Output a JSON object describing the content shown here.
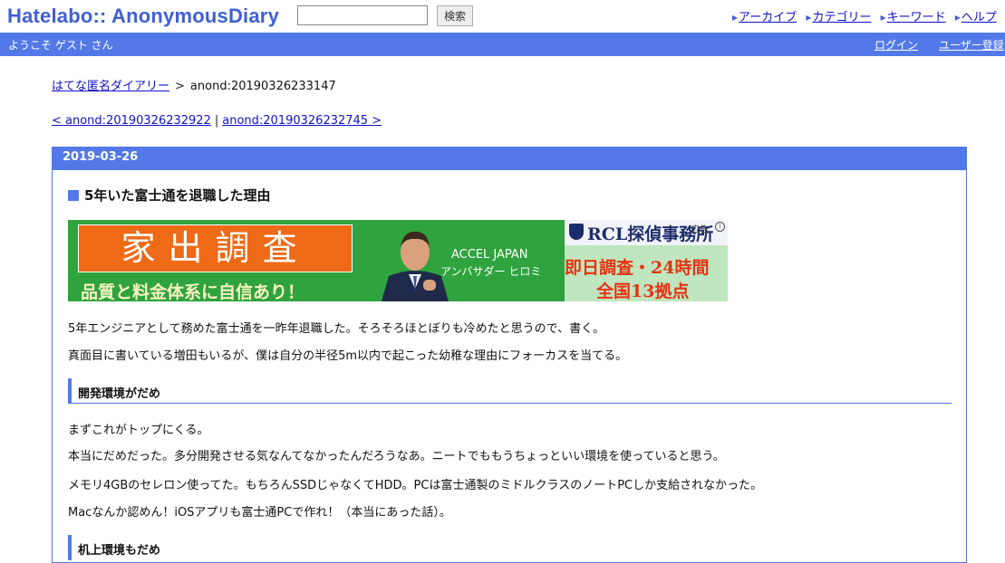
{
  "header": {
    "logo": "Hatelabo:: AnonymousDiary",
    "search_placeholder": "",
    "search_button": "検索",
    "nav": [
      {
        "label": "アーカイブ"
      },
      {
        "label": "カテゴリー"
      },
      {
        "label": "キーワード"
      },
      {
        "label": "ヘルプ"
      }
    ]
  },
  "userbar": {
    "welcome": "ようこそ ゲスト さん",
    "login": "ログイン",
    "register": "ユーザー登録"
  },
  "breadcrumb": {
    "home": "はてな匿名ダイアリー",
    "separator": ">",
    "current": "anond:20190326233147"
  },
  "prevnext": {
    "prev": "< anond:20190326232922",
    "separator": "|",
    "next": "anond:20190326232745 >"
  },
  "section": {
    "date": "2019-03-26",
    "title": "5年いた富士通を退職した理由"
  },
  "ad": {
    "headline": "家出調査",
    "subline": "品質と料金体系に自信あり！",
    "caption1": "ACCEL JAPAN",
    "caption2": "アンバサダー ヒロミ",
    "brand": "RCL探偵事務所",
    "badge": "広告",
    "red1": "即日調査・24時間",
    "red2": "全国13拠点"
  },
  "body": {
    "intro": [
      "5年エンジニアとして務めた富士通を一昨年退職した。そろそろほとぼりも冷めたと思うので、書く。",
      "真面目に書いている増田もいるが、僕は自分の半径5m以内で起こった幼稚な理由にフォーカスを当てる。"
    ],
    "section1_heading": "開発環境がだめ",
    "section1": [
      "まずこれがトップにくる。",
      "本当にだめだった。多分開発させる気なんてなかったんだろうなあ。ニートでももうちょっといい環境を使っていると思う。",
      "メモリ4GBのセレロン使ってた。もちろんSSDじゃなくてHDD。PCは富士通製のミドルクラスのノートPCしか支給されなかった。",
      "Macなんか認めん！iOSアプリも富士通PCで作れ！（本当にあった話）。"
    ],
    "section2_heading": "机上環境もだめ"
  },
  "colors": {
    "brand_blue": "#5279e7",
    "link": "#1111cc",
    "ad_green": "#2fa33e",
    "ad_orange": "#ee6a16"
  }
}
